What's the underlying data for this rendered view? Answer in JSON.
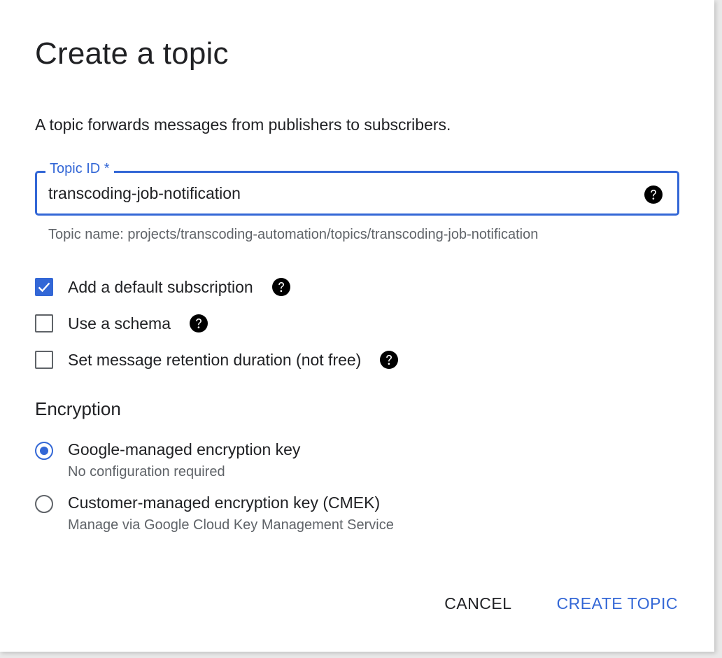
{
  "dialog": {
    "title": "Create a topic",
    "description": "A topic forwards messages from publishers to subscribers."
  },
  "topic_id": {
    "label": "Topic ID *",
    "value": "transcoding-job-notification",
    "help_icon": "help-circle-icon",
    "hint": "Topic name: projects/transcoding-automation/topics/transcoding-job-notification"
  },
  "options": [
    {
      "label": "Add a default subscription",
      "checked": true
    },
    {
      "label": "Use a schema",
      "checked": false
    },
    {
      "label": "Set message retention duration (not free)",
      "checked": false
    }
  ],
  "encryption": {
    "title": "Encryption",
    "choices": [
      {
        "label": "Google-managed encryption key",
        "sub": "No configuration required",
        "selected": true
      },
      {
        "label": "Customer-managed encryption key (CMEK)",
        "sub": "Manage via Google Cloud Key Management Service",
        "selected": false
      }
    ]
  },
  "actions": {
    "cancel": "CANCEL",
    "create": "CREATE TOPIC"
  },
  "colors": {
    "accent": "#3367d6",
    "text": "#202124",
    "secondary_text": "#5f6368"
  }
}
